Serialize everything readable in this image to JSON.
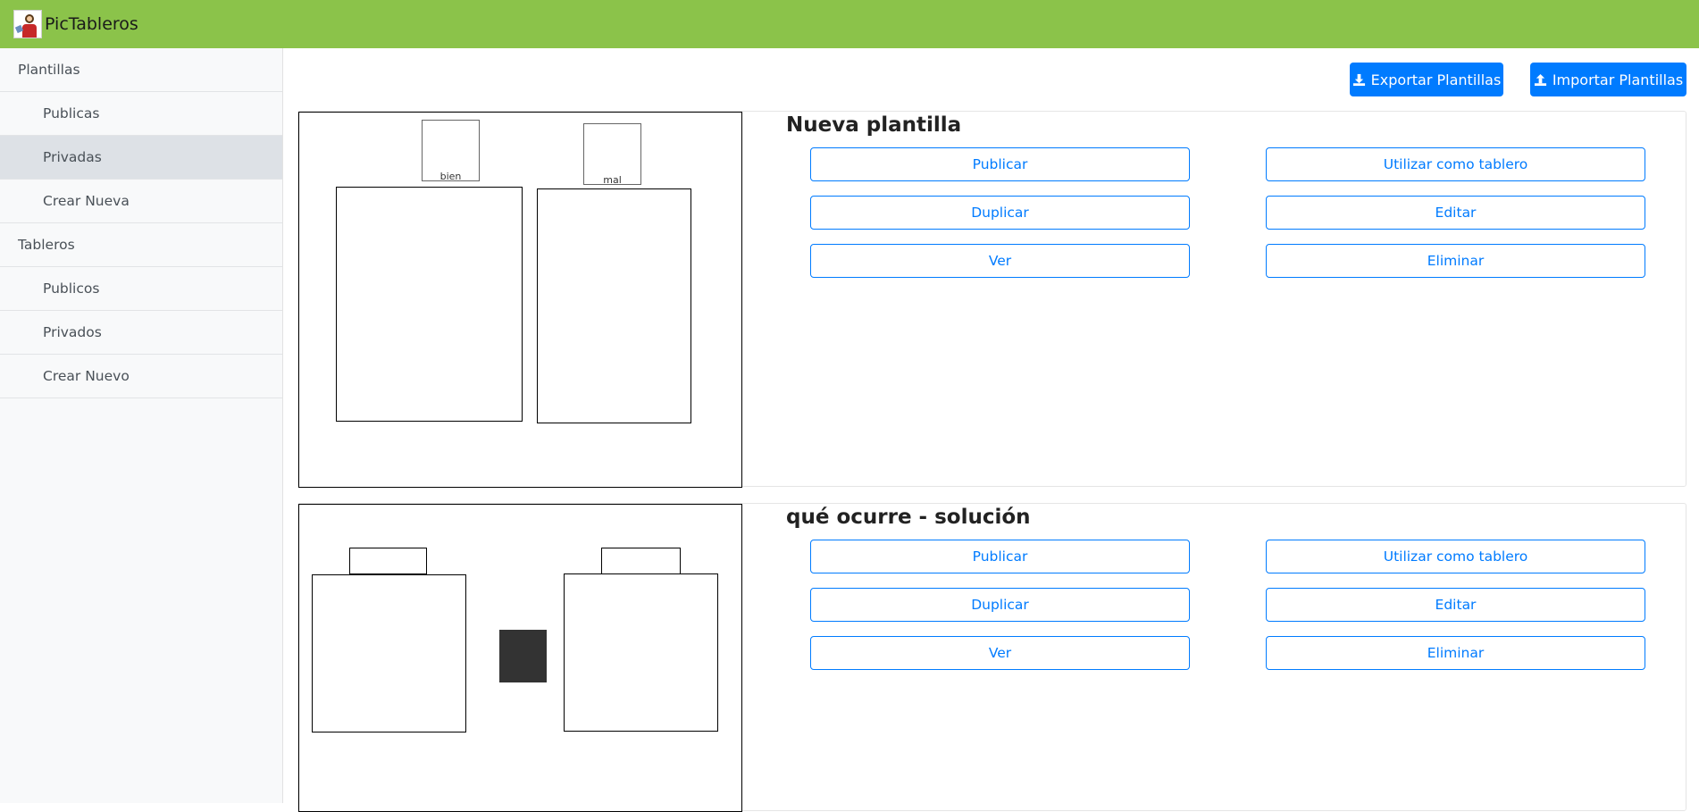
{
  "app": {
    "brand": "PicTableros"
  },
  "sidebar": {
    "items": [
      {
        "label": "Plantillas"
      },
      {
        "label": "Publicas"
      },
      {
        "label": "Privadas"
      },
      {
        "label": "Crear Nueva"
      },
      {
        "label": "Tableros"
      },
      {
        "label": "Publicos"
      },
      {
        "label": "Privados"
      },
      {
        "label": "Crear Nuevo"
      }
    ]
  },
  "toolbar": {
    "export_label": "Exportar Plantillas",
    "import_label": "Importar Plantillas"
  },
  "templates": [
    {
      "title": "Nueva plantilla",
      "preview_labels": [
        "bien",
        "mal"
      ],
      "actions": [
        "Publicar",
        "Utilizar como tablero",
        "Duplicar",
        "Editar",
        "Ver",
        "Eliminar"
      ]
    },
    {
      "title": "qué ocurre - solución",
      "actions": [
        "Publicar",
        "Utilizar como tablero",
        "Duplicar",
        "Editar",
        "Ver",
        "Eliminar"
      ]
    }
  ],
  "colors": {
    "header": "#8bc34a",
    "primary": "#007bff",
    "sidebar_bg": "#f8f9fa",
    "sidebar_active": "#dde1e6"
  },
  "icons": [
    "logo-icon",
    "download-icon",
    "upload-icon"
  ]
}
